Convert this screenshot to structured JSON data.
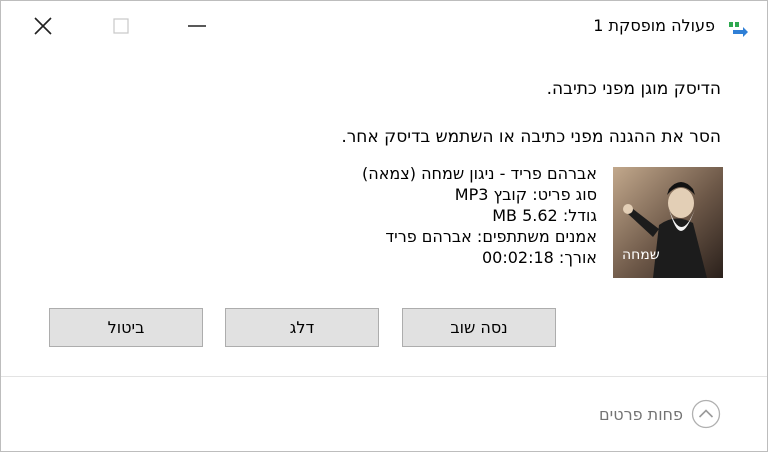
{
  "window": {
    "title": "פעולה מופסקת 1",
    "icon": "copy-progress-icon",
    "controls": {
      "minimize": "minimize-icon",
      "maximize": "maximize-icon",
      "close": "close-icon"
    }
  },
  "message": {
    "line1": "הדיסק מוגן מפני כתיבה.",
    "line2": "הסר את ההגנה מפני כתיבה או השתמש בדיסק אחר."
  },
  "file": {
    "thumbnail": "album-art-thumbnail",
    "name": "אברהם פריד - ניגון שמחה (צמאה)",
    "type": "סוג פריט: קובץ MP3",
    "size": "גודל: 5.62 MB",
    "artists": "אמנים משתתפים: אברהם פריד",
    "length": "אורך: 00:02:18"
  },
  "buttons": {
    "retry": "נסה שוב",
    "skip": "דלג",
    "cancel": "ביטול"
  },
  "footer": {
    "fewer_details": "פחות פרטים",
    "icon": "chevron-up-circle-icon"
  }
}
